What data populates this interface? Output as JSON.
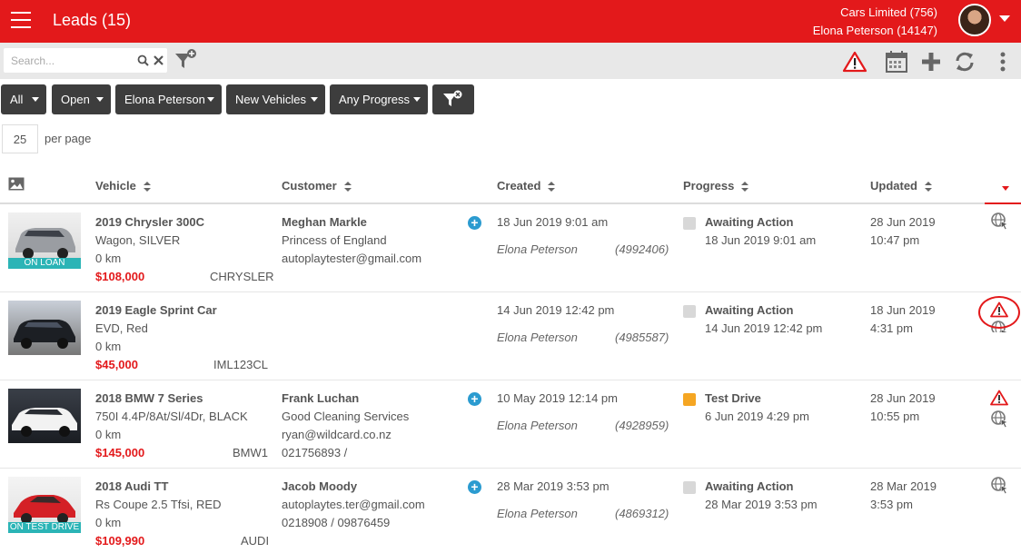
{
  "header": {
    "title": "Leads (15)",
    "company": "Cars Limited (756)",
    "user": "Elona Peterson (14147)"
  },
  "toolbar": {
    "search_placeholder": "Search..."
  },
  "filters": [
    "All",
    "Open",
    "Elona Peterson",
    "New Vehicles",
    "Any Progress"
  ],
  "pagination": {
    "per_page_value": "25",
    "per_page_label": "per page"
  },
  "columns": {
    "vehicle": "Vehicle",
    "customer": "Customer",
    "created": "Created",
    "progress": "Progress",
    "updated": "Updated"
  },
  "rows": [
    {
      "badge": "ON LOAN",
      "vehicle_title": "2019 Chrysler 300C",
      "vehicle_desc": "Wagon, SILVER",
      "km": "0 km",
      "price": "$108,000",
      "stock": "CHRYSLER",
      "customer_name": "Meghan Markle",
      "customer_line2": "Princess of England",
      "customer_line3": "autoplaytester@gmail.com",
      "customer_line4": "",
      "created": "18 Jun 2019 9:01 am",
      "agent": "Elona Peterson",
      "lead_id": "(4992406)",
      "progress_status": "Awaiting Action",
      "progress_date": "18 Jun 2019 9:01 am",
      "updated_date": "28 Jun 2019",
      "updated_time": "10:47 pm"
    },
    {
      "badge": "",
      "vehicle_title": "2019 Eagle Sprint Car",
      "vehicle_desc": "EVD, Red",
      "km": "0 km",
      "price": "$45,000",
      "stock": "IML123CL",
      "customer_name": "",
      "customer_line2": "",
      "customer_line3": "",
      "customer_line4": "",
      "created": "14 Jun 2019 12:42 pm",
      "agent": "Elona Peterson",
      "lead_id": "(4985587)",
      "progress_status": "Awaiting Action",
      "progress_date": "14 Jun 2019 12:42 pm",
      "updated_date": "18 Jun 2019",
      "updated_time": "4:31 pm"
    },
    {
      "badge": "",
      "vehicle_title": "2018 BMW 7 Series",
      "vehicle_desc": "750I 4.4P/8At/Sl/4Dr, BLACK",
      "km": "0 km",
      "price": "$145,000",
      "stock": "BMW1",
      "customer_name": "Frank Luchan",
      "customer_line2": "Good Cleaning Services",
      "customer_line3": "ryan@wildcard.co.nz",
      "customer_line4": "021756893 /",
      "created": "10 May 2019 12:14 pm",
      "agent": "Elona Peterson",
      "lead_id": "(4928959)",
      "progress_status": "Test Drive",
      "progress_date": "6 Jun 2019 4:29 pm",
      "updated_date": "28 Jun 2019",
      "updated_time": "10:55 pm"
    },
    {
      "badge": "ON TEST DRIVE",
      "vehicle_title": "2018 Audi TT",
      "vehicle_desc": "Rs Coupe 2.5 Tfsi, RED",
      "km": "0 km",
      "price": "$109,990",
      "stock": "AUDI",
      "customer_name": "Jacob Moody",
      "customer_line2": "autoplaytes.ter@gmail.com",
      "customer_line3": "0218908 / 09876459",
      "customer_line4": "",
      "created": "28 Mar 2019 3:53 pm",
      "agent": "Elona Peterson",
      "lead_id": "(4869312)",
      "progress_status": "Awaiting Action",
      "progress_date": "28 Mar 2019 3:53 pm",
      "updated_date": "28 Mar 2019",
      "updated_time": "3:53 pm"
    }
  ],
  "colors": {
    "brand_red": "#e3191b",
    "toolbar_gray": "#e8e8e8",
    "filter_dark": "#3d3d3d",
    "badge_teal": "#2bb4b6",
    "add_blue": "#2b9bd0",
    "status_orange": "#f5a623"
  }
}
